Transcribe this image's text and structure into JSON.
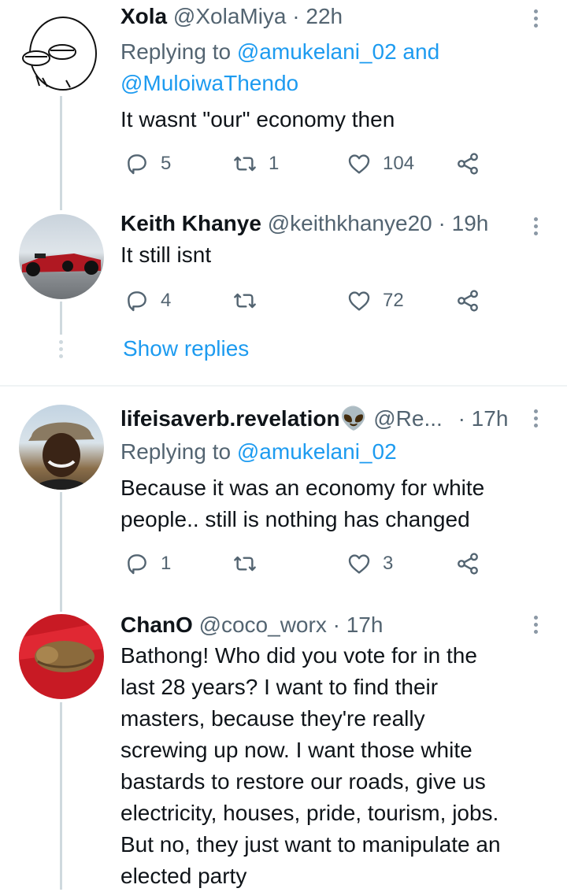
{
  "tweets": [
    {
      "name": "Xola",
      "handle": "@XolaMiya",
      "time": "· 22h",
      "replying_prefix": "Replying to ",
      "replying_mention_1": "@amukelani_02",
      "replying_and": " and",
      "replying_mention_2": "@MuloiwaThendo",
      "text": "It wasnt \"our\" economy then",
      "replies": "5",
      "retweets": "1",
      "likes": "104"
    },
    {
      "name": "Keith Khanye",
      "handle": "@keithkhanye20",
      "time": "· 19h",
      "text": "It still isnt",
      "replies": "4",
      "retweets": "",
      "likes": "72"
    },
    {
      "name": "lifeisaverb.revelation",
      "emoji": "👽",
      "handle": "@Re...",
      "time": "· 17h",
      "replying_prefix": "Replying to ",
      "replying_mention_1": "@amukelani_02",
      "text_line_1": "Because it was an economy for white",
      "text_line_2": "people.. still is nothing has changed",
      "replies": "1",
      "retweets": "",
      "likes": "3"
    },
    {
      "name": "ChanO",
      "handle": "@coco_worx",
      "time": "· 17h",
      "text_lines": [
        "Bathong! Who did you vote for in the",
        "last 28 years? I want to find their",
        "masters, because they're really",
        "screwing up now. I want those white",
        "bastards to restore our roads, give us",
        "electricity, houses, pride, tourism, jobs.",
        "But no, they just want to manipulate an",
        "elected party"
      ]
    }
  ],
  "show_replies": "Show replies",
  "icons": {
    "reply": "reply-icon",
    "retweet": "retweet-icon",
    "like": "heart-icon",
    "share": "share-icon",
    "more": "more-vertical-icon"
  },
  "colors": {
    "link": "#1d9bf0",
    "muted": "#536471",
    "thread_line": "#cfd9de"
  }
}
